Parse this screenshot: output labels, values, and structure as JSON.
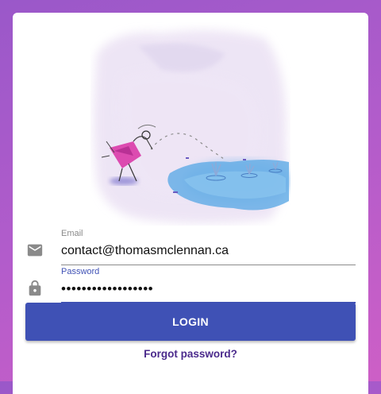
{
  "form": {
    "email": {
      "label": "Email",
      "value": "contact@thomasmclennan.ca",
      "icon": "envelope-icon"
    },
    "password": {
      "label": "Password",
      "value": "000000000000000000",
      "icon": "lock-icon"
    },
    "login_label": "LOGIN",
    "forgot_label": "Forgot password?"
  },
  "colors": {
    "primary": "#3f51b5",
    "link": "#4b2a8c",
    "background_start": "#9a58c9",
    "background_end": "#cd5fc6"
  }
}
